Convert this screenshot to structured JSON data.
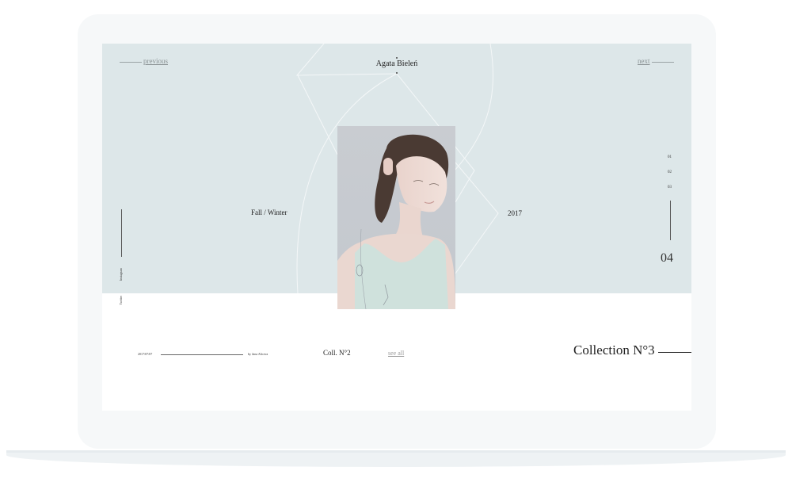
{
  "header": {
    "previous_label": "previous",
    "next_label": "next",
    "brand": "Agata Bieleń"
  },
  "hero": {
    "season_label": "Fall / Winter",
    "year_label": "2017",
    "photo_alt": "Model wearing pale mint top with delicate jewelry"
  },
  "pager": {
    "items": [
      "01",
      "02",
      "03"
    ],
    "current": "04"
  },
  "social": {
    "items": [
      "Instagram",
      "Twitter"
    ]
  },
  "footer": {
    "date": "2017/07/07",
    "author": "by Jana Aliceva",
    "collection_small": "Coll. N°2",
    "see_all_label": "see all",
    "collection_big": "Collection N°3"
  },
  "colors": {
    "hero_bg": "#dde7e9",
    "accent_text": "#222222",
    "muted_link": "#8a9294"
  }
}
